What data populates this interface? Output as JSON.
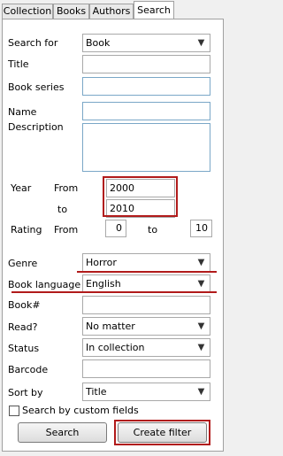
{
  "tabs": [
    "Collection",
    "Books",
    "Authors",
    "Search"
  ],
  "labels": {
    "search_for": "Search for",
    "title": "Title",
    "book_series": "Book series",
    "name": "Name",
    "description": "Description",
    "year": "Year",
    "from": "From",
    "to": "to",
    "rating": "Rating",
    "genre": "Genre",
    "book_language": "Book language",
    "book_num": "Book#",
    "read": "Read?",
    "status": "Status",
    "barcode": "Barcode",
    "sort_by": "Sort by",
    "search_custom": "Search by custom fields"
  },
  "values": {
    "search_for": "Book",
    "year_from": "2000",
    "year_to": "2010",
    "rating_from": "0",
    "rating_to": "10",
    "genre": "Horror",
    "book_language": "English",
    "read": "No matter",
    "status": "In collection",
    "sort_by": "Title"
  },
  "buttons": {
    "search": "Search",
    "create_filter": "Create filter"
  },
  "colors": {
    "highlight": "#b11b1b",
    "field_border": "#7aa7c7"
  }
}
